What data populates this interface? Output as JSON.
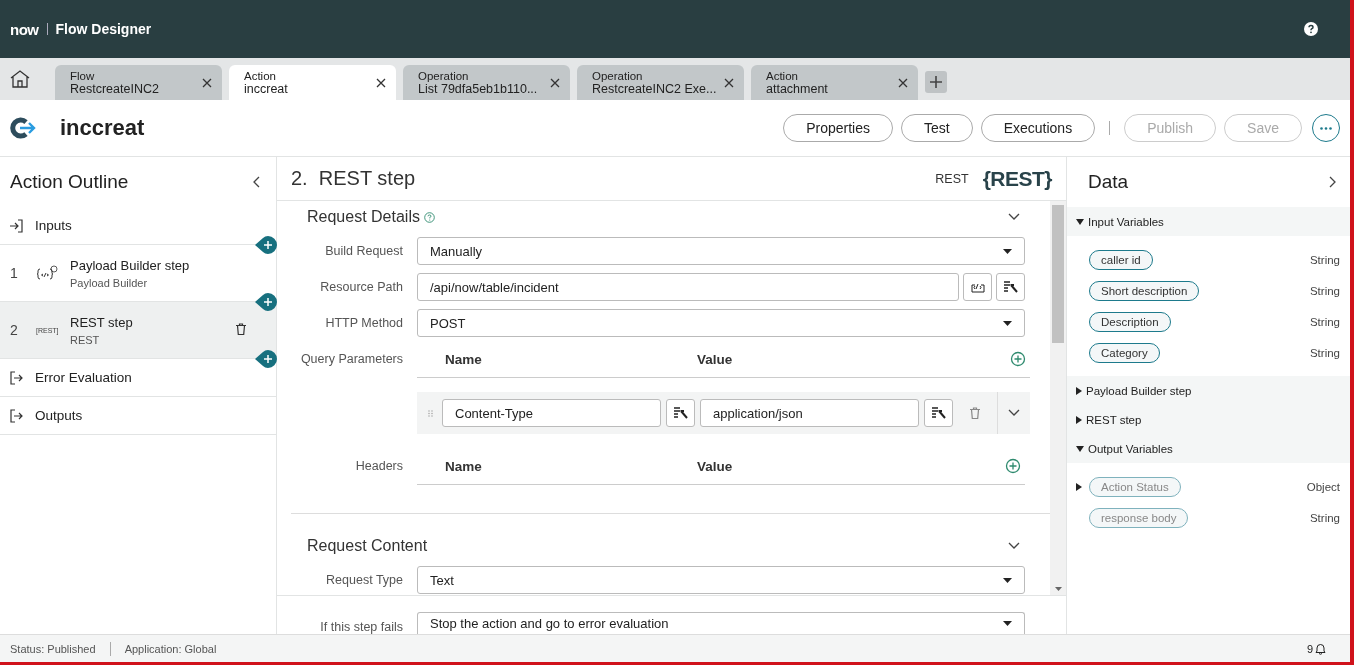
{
  "header": {
    "brand": "now",
    "title": "Flow Designer"
  },
  "tabs": [
    {
      "type": "Flow",
      "name": "RestcreateINC2",
      "selected": false
    },
    {
      "type": "Action",
      "name": "inccreat",
      "selected": true
    },
    {
      "type": "Operation",
      "name": "List 79dfa5eb1b110...",
      "selected": false
    },
    {
      "type": "Operation",
      "name": "RestcreateINC2 Exe...",
      "selected": false
    },
    {
      "type": "Action",
      "name": "attachment",
      "selected": false
    }
  ],
  "action": {
    "title": "inccreat",
    "buttons": [
      {
        "label": "Properties",
        "disabled": false
      },
      {
        "label": "Test",
        "disabled": false
      },
      {
        "label": "Executions",
        "disabled": false
      },
      {
        "label": "Publish",
        "disabled": true
      },
      {
        "label": "Save",
        "disabled": true
      }
    ]
  },
  "outline": {
    "title": "Action Outline",
    "items": [
      {
        "kind": "input",
        "label": "Inputs",
        "selected": false
      },
      {
        "kind": "step",
        "number": "1",
        "label": "Payload Builder step",
        "sub": "Payload Builder",
        "selected": false
      },
      {
        "kind": "step",
        "number": "2",
        "icon_text": "[REST]",
        "label": "REST step",
        "sub": "REST",
        "selected": true
      },
      {
        "kind": "output",
        "label": "Error Evaluation",
        "selected": false
      },
      {
        "kind": "output",
        "label": "Outputs",
        "selected": false
      }
    ]
  },
  "step": {
    "number": "2.",
    "title": "REST step",
    "type": "REST",
    "badge": "{REST}"
  },
  "request_details": {
    "title": "Request Details",
    "fields": [
      {
        "kind": "select",
        "label": "Build Request",
        "value": "Manually"
      },
      {
        "kind": "text",
        "label": "Resource Path",
        "value": "/api/now/table/incident"
      },
      {
        "kind": "select",
        "label": "HTTP Method",
        "value": "POST"
      }
    ],
    "query_parameters": {
      "label": "Query Parameters",
      "columns": [
        "Name",
        "Value"
      ],
      "rows": [
        {
          "name": "Content-Type",
          "value": "application/json"
        }
      ]
    },
    "headers": {
      "label": "Headers",
      "columns": [
        "Name",
        "Value"
      ]
    }
  },
  "request_content": {
    "title": "Request Content",
    "fields": [
      {
        "kind": "select",
        "label": "Request Type",
        "value": "Text"
      }
    ]
  },
  "failure": {
    "label": "If this step fails",
    "value": "Stop the action and go to error evaluation"
  },
  "data_panel": {
    "title": "Data",
    "groups": [
      {
        "label": "Input Variables",
        "expanded": true,
        "items": [
          {
            "name": "caller id",
            "type": "String",
            "readonly": false,
            "expandable": false
          },
          {
            "name": "Short description",
            "type": "String",
            "readonly": false,
            "expandable": false
          },
          {
            "name": "Description",
            "type": "String",
            "readonly": false,
            "expandable": false
          },
          {
            "name": "Category",
            "type": "String",
            "readonly": false,
            "expandable": false
          }
        ]
      },
      {
        "label": "Payload Builder step",
        "expanded": false
      },
      {
        "label": "REST step",
        "expanded": false
      },
      {
        "label": "Output Variables",
        "expanded": true,
        "items": [
          {
            "name": "Action Status",
            "type": "Object",
            "readonly": true,
            "expandable": true
          },
          {
            "name": "response body",
            "type": "String",
            "readonly": true,
            "expandable": false
          }
        ]
      }
    ]
  },
  "status_bar": {
    "status": "Status: Published",
    "application": "Application: Global",
    "notifications": "9"
  }
}
